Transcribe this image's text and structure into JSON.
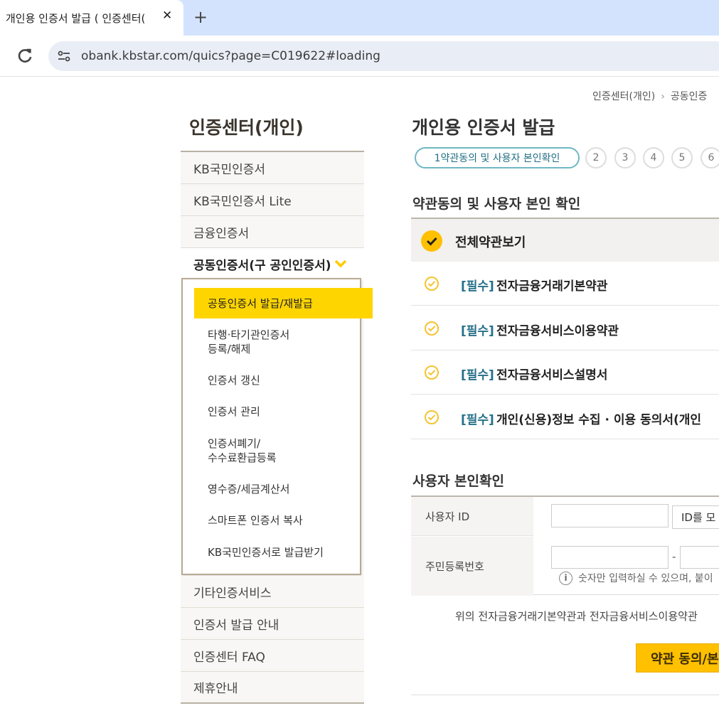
{
  "browser": {
    "tab_title": "개인용 인증서 발급 ( 인증센터(",
    "tab_close": "✕",
    "new_tab": "+",
    "url": "obank.kbstar.com/quics?page=C019622#loading"
  },
  "breadcrumb": {
    "items": [
      "인증센터(개인)",
      "공동인증"
    ],
    "separator": "›"
  },
  "lnb": {
    "title": "인증센터(개인)",
    "items_top": [
      "KB국민인증서",
      "KB국민인증서 Lite",
      "금융인증서"
    ],
    "active": "공동인증서(구 공인인증서)",
    "sub_items": [
      "공동인증서 발급/재발급",
      "타행·타기관인증서\n등록/해제",
      "인증서 갱신",
      "인증서 관리",
      "인증서폐기/\n수수료환급등록",
      "영수증/세금계산서",
      "스마트폰 인증서 복사",
      "KB국민인증서로 발급받기"
    ],
    "items_bottom": [
      "기타인증서비스",
      "인증서 발급 안내",
      "인증센터 FAQ",
      "제휴안내"
    ]
  },
  "main": {
    "title": "개인용 인증서 발급",
    "step_active": "1약관동의 및 사용자 본인확인",
    "steps": [
      "2",
      "3",
      "4",
      "5",
      "6"
    ],
    "terms_title": "약관동의 및 사용자 본인 확인",
    "agree_all": "전체약관보기",
    "required_tag": "[필수]",
    "terms": [
      "전자금융거래기본약관",
      "전자금융서비스이용약관",
      "전자금융서비스설명서",
      "개인(신용)정보 수집 · 이용 동의서(개인"
    ],
    "id_title": "사용자 본인확인",
    "user_id_label": "사용자 ID",
    "id_lookup_button": "ID를 모",
    "rrn_label": "주민등록번호",
    "rrn_dash": "-",
    "hint": "숫자만 입력하실 수 있으며, 붙이",
    "notice": "위의 전자금융거래기본약관과 전자금융서비스이용약관",
    "agree_button": "약관 동의/본"
  },
  "colors": {
    "accent": "#ffc000",
    "highlight": "#ffd500",
    "teal": "#267089"
  }
}
